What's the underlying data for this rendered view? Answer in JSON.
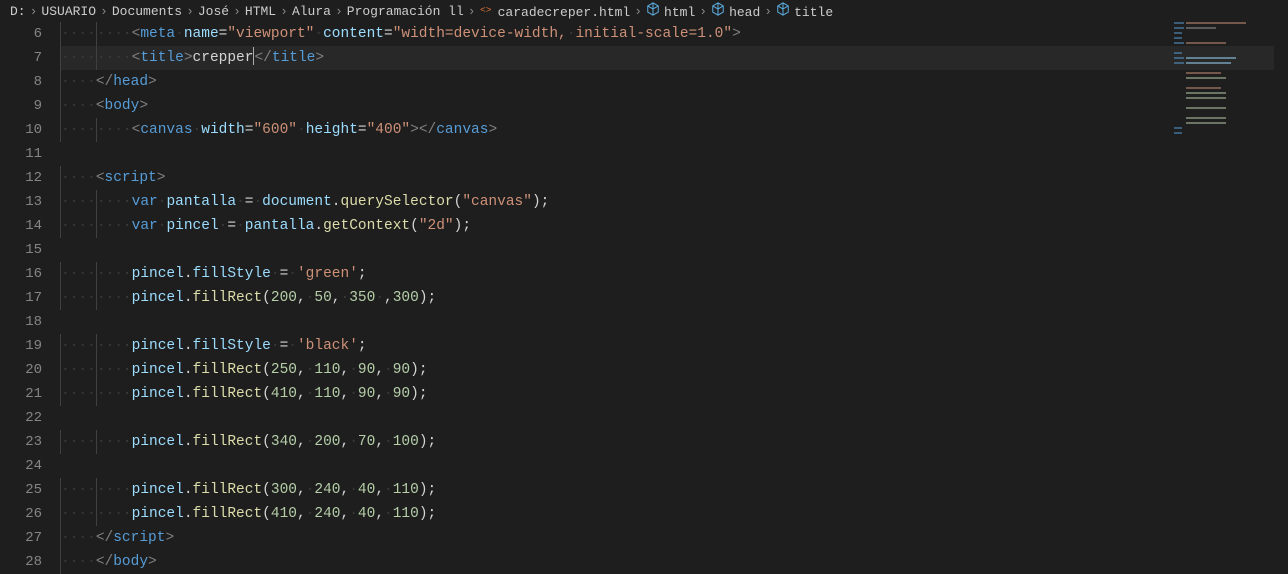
{
  "breadcrumbs": {
    "items": [
      {
        "label": "D:",
        "icon": null
      },
      {
        "label": "USUARIO",
        "icon": null
      },
      {
        "label": "Documents",
        "icon": null
      },
      {
        "label": "José",
        "icon": null
      },
      {
        "label": "HTML",
        "icon": null
      },
      {
        "label": "Alura",
        "icon": null
      },
      {
        "label": "Programación ll",
        "icon": null
      },
      {
        "label": "caradecreper.html",
        "icon": "file-html"
      },
      {
        "label": "html",
        "icon": "symbol"
      },
      {
        "label": "head",
        "icon": "symbol"
      },
      {
        "label": "title",
        "icon": "symbol"
      }
    ]
  },
  "editor": {
    "active_line": 7,
    "cursor_col_after": "crepper",
    "lines": [
      {
        "num": 6,
        "indent": 2,
        "html": "<span class='tag-bracket'>&lt;</span><span class='tag-name'>meta</span><span class='ws'>·</span><span class='attr-name'>name</span><span class='op'>=</span><span class='attr-val'>\"viewport\"</span><span class='ws'>·</span><span class='attr-name'>content</span><span class='op'>=</span><span class='attr-val'>\"width=device-width,<span class='ws'>·</span>initial-scale=1.0\"</span><span class='tag-bracket'>&gt;</span>"
      },
      {
        "num": 7,
        "indent": 2,
        "active": true,
        "html": "<span class='tag-bracket'>&lt;</span><span class='tag-name'>title</span><span class='tag-bracket'>&gt;</span><span class='text'>crepper</span><span class='cursor' data-name='text-cursor'></span><span class='tag-bracket'>&lt;/</span><span class='tag-name'>title</span><span class='tag-bracket'>&gt;</span>"
      },
      {
        "num": 8,
        "indent": 1,
        "html": "<span class='tag-bracket'>&lt;/</span><span class='tag-name'>head</span><span class='tag-bracket'>&gt;</span>"
      },
      {
        "num": 9,
        "indent": 1,
        "html": "<span class='tag-bracket'>&lt;</span><span class='tag-name'>body</span><span class='tag-bracket'>&gt;</span>"
      },
      {
        "num": 10,
        "indent": 2,
        "html": "<span class='tag-bracket'>&lt;</span><span class='tag-name'>canvas</span><span class='ws'>·</span><span class='attr-name'>width</span><span class='op'>=</span><span class='attr-val'>\"600\"</span><span class='ws'>·</span><span class='attr-name'>height</span><span class='op'>=</span><span class='attr-val'>\"400\"</span><span class='tag-bracket'>&gt;&lt;/</span><span class='tag-name'>canvas</span><span class='tag-bracket'>&gt;</span>"
      },
      {
        "num": 11,
        "indent": 0,
        "html": ""
      },
      {
        "num": 12,
        "indent": 1,
        "html": "<span class='tag-bracket'>&lt;</span><span class='tag-name'>script</span><span class='tag-bracket'>&gt;</span>"
      },
      {
        "num": 13,
        "indent": 2,
        "html": "<span class='keyword'>var</span><span class='ws'>·</span><span class='var-name'>pantalla</span><span class='ws'>·</span><span class='op'>=</span><span class='ws'>·</span><span class='obj'>document</span><span class='punc'>.</span><span class='method'>querySelector</span><span class='punc'>(</span><span class='string'>\"canvas\"</span><span class='punc'>);</span>"
      },
      {
        "num": 14,
        "indent": 2,
        "html": "<span class='keyword'>var</span><span class='ws'>·</span><span class='var-name'>pincel</span><span class='ws'>·</span><span class='op'>=</span><span class='ws'>·</span><span class='obj'>pantalla</span><span class='punc'>.</span><span class='method'>getContext</span><span class='punc'>(</span><span class='string'>\"2d\"</span><span class='punc'>);</span>"
      },
      {
        "num": 15,
        "indent": 0,
        "html": ""
      },
      {
        "num": 16,
        "indent": 2,
        "html": "<span class='obj'>pincel</span><span class='punc'>.</span><span class='var-name'>fillStyle</span><span class='ws'>·</span><span class='op'>=</span><span class='ws'>·</span><span class='string'>'green'</span><span class='punc'>;</span>"
      },
      {
        "num": 17,
        "indent": 2,
        "html": "<span class='obj'>pincel</span><span class='punc'>.</span><span class='method'>fillRect</span><span class='punc'>(</span><span class='number'>200</span><span class='punc'>,</span><span class='ws'>·</span><span class='number'>50</span><span class='punc'>,</span><span class='ws'>·</span><span class='number'>350</span><span class='ws'>·</span><span class='punc'>,</span><span class='number'>300</span><span class='punc'>);</span>"
      },
      {
        "num": 18,
        "indent": 0,
        "html": ""
      },
      {
        "num": 19,
        "indent": 2,
        "html": "<span class='obj'>pincel</span><span class='punc'>.</span><span class='var-name'>fillStyle</span><span class='ws'>·</span><span class='op'>=</span><span class='ws'>·</span><span class='string'>'black'</span><span class='punc'>;</span>"
      },
      {
        "num": 20,
        "indent": 2,
        "html": "<span class='obj'>pincel</span><span class='punc'>.</span><span class='method'>fillRect</span><span class='punc'>(</span><span class='number'>250</span><span class='punc'>,</span><span class='ws'>·</span><span class='number'>110</span><span class='punc'>,</span><span class='ws'>·</span><span class='number'>90</span><span class='punc'>,</span><span class='ws'>·</span><span class='number'>90</span><span class='punc'>);</span>"
      },
      {
        "num": 21,
        "indent": 2,
        "html": "<span class='obj'>pincel</span><span class='punc'>.</span><span class='method'>fillRect</span><span class='punc'>(</span><span class='number'>410</span><span class='punc'>,</span><span class='ws'>·</span><span class='number'>110</span><span class='punc'>,</span><span class='ws'>·</span><span class='number'>90</span><span class='punc'>,</span><span class='ws'>·</span><span class='number'>90</span><span class='punc'>);</span>"
      },
      {
        "num": 22,
        "indent": 0,
        "html": ""
      },
      {
        "num": 23,
        "indent": 2,
        "html": "<span class='obj'>pincel</span><span class='punc'>.</span><span class='method'>fillRect</span><span class='punc'>(</span><span class='number'>340</span><span class='punc'>,</span><span class='ws'>·</span><span class='number'>200</span><span class='punc'>,</span><span class='ws'>·</span><span class='number'>70</span><span class='punc'>,</span><span class='ws'>·</span><span class='number'>100</span><span class='punc'>);</span>"
      },
      {
        "num": 24,
        "indent": 0,
        "html": ""
      },
      {
        "num": 25,
        "indent": 2,
        "html": "<span class='obj'>pincel</span><span class='punc'>.</span><span class='method'>fillRect</span><span class='punc'>(</span><span class='number'>300</span><span class='punc'>,</span><span class='ws'>·</span><span class='number'>240</span><span class='punc'>,</span><span class='ws'>·</span><span class='number'>40</span><span class='punc'>,</span><span class='ws'>·</span><span class='number'>110</span><span class='punc'>);</span>"
      },
      {
        "num": 26,
        "indent": 2,
        "html": "<span class='obj'>pincel</span><span class='punc'>.</span><span class='method'>fillRect</span><span class='punc'>(</span><span class='number'>410</span><span class='punc'>,</span><span class='ws'>·</span><span class='number'>240</span><span class='punc'>,</span><span class='ws'>·</span><span class='number'>40</span><span class='punc'>,</span><span class='ws'>·</span><span class='number'>110</span><span class='punc'>);</span>"
      },
      {
        "num": 27,
        "indent": 1,
        "html": "<span class='tag-bracket'>&lt;/</span><span class='tag-name'>script</span><span class='tag-bracket'>&gt;</span>"
      },
      {
        "num": 28,
        "indent": 1,
        "html": "<span class='tag-bracket'>&lt;/</span><span class='tag-name'>body</span><span class='tag-bracket'>&gt;</span>"
      }
    ]
  }
}
